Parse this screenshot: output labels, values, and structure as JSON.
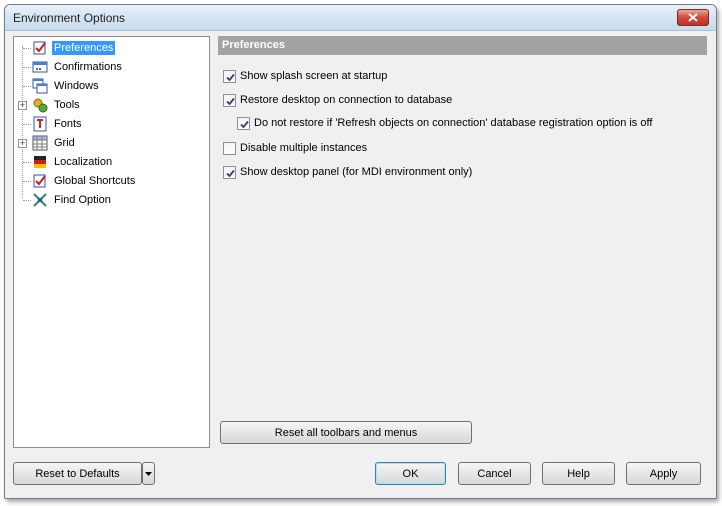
{
  "window": {
    "title": "Environment Options"
  },
  "tree": {
    "items": [
      {
        "label": "Preferences",
        "icon": "preferences-icon",
        "selected": true
      },
      {
        "label": "Confirmations",
        "icon": "confirmations-icon"
      },
      {
        "label": "Windows",
        "icon": "windows-icon"
      },
      {
        "label": "Tools",
        "icon": "tools-icon",
        "expandable": true
      },
      {
        "label": "Fonts",
        "icon": "fonts-icon"
      },
      {
        "label": "Grid",
        "icon": "grid-icon",
        "expandable": true
      },
      {
        "label": "Localization",
        "icon": "localization-icon"
      },
      {
        "label": "Global Shortcuts",
        "icon": "shortcuts-icon"
      },
      {
        "label": "Find Option",
        "icon": "find-option-icon"
      }
    ]
  },
  "section": {
    "title": "Preferences"
  },
  "options": {
    "splash": {
      "label": "Show splash screen at startup",
      "checked": true
    },
    "restore_desktop": {
      "label": "Restore desktop on connection to database",
      "checked": true
    },
    "no_restore_refresh": {
      "label": "Do not restore if 'Refresh objects on connection' database registration option is off",
      "checked": true
    },
    "disable_multi": {
      "label": "Disable multiple instances",
      "checked": false
    },
    "desktop_panel": {
      "label": "Show desktop panel (for MDI environment only)",
      "checked": true
    }
  },
  "buttons": {
    "reset_toolbars": "Reset all toolbars and menus",
    "reset_defaults": "Reset to Defaults",
    "ok": "OK",
    "cancel": "Cancel",
    "help": "Help",
    "apply": "Apply"
  },
  "colors": {
    "selection": "#3399ff",
    "header_bg": "#a3a3a3"
  }
}
